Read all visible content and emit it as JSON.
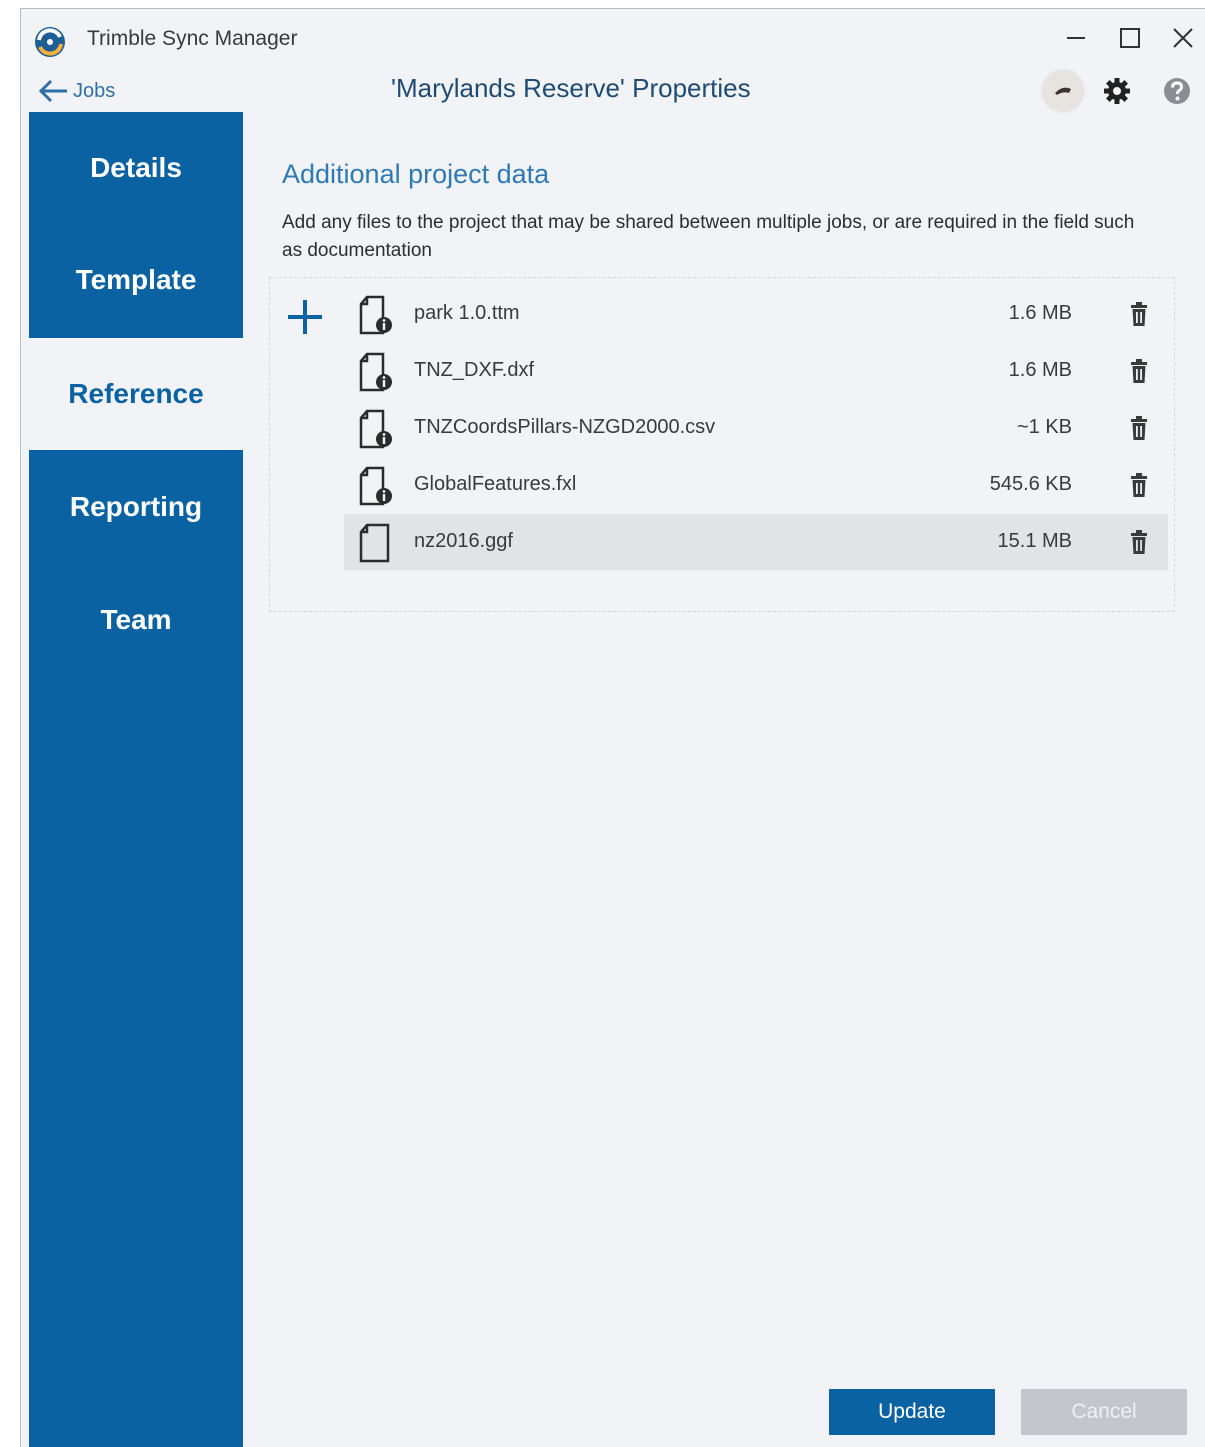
{
  "window": {
    "app_title": "Trimble Sync Manager",
    "controls": {
      "minimize": "minimize-icon",
      "maximize": "maximize-icon",
      "close": "close-icon"
    }
  },
  "header": {
    "back_label": "Jobs",
    "title": "'Marylands Reserve' Properties",
    "icons": [
      "avatar",
      "gear-icon",
      "help-icon"
    ]
  },
  "sidebar": {
    "items": [
      {
        "label": "Details",
        "active": false
      },
      {
        "label": "Template",
        "active": false
      },
      {
        "label": "Reference",
        "active": true
      },
      {
        "label": "Reporting",
        "active": false
      },
      {
        "label": "Team",
        "active": false
      }
    ]
  },
  "main": {
    "section_title": "Additional project data",
    "description": "Add any files to the project that may be shared between multiple jobs, or are required in the field such as documentation",
    "files": [
      {
        "name": "park 1.0.ttm",
        "size": "1.6 MB",
        "icon": "file-info-icon",
        "selected": false
      },
      {
        "name": "TNZ_DXF.dxf",
        "size": "1.6 MB",
        "icon": "file-info-icon",
        "selected": false
      },
      {
        "name": "TNZCoordsPillars-NZGD2000.csv",
        "size": "~1 KB",
        "icon": "file-info-icon",
        "selected": false
      },
      {
        "name": "GlobalFeatures.fxl",
        "size": "545.6 KB",
        "icon": "file-info-icon",
        "selected": false
      },
      {
        "name": "nz2016.ggf",
        "size": "15.1 MB",
        "icon": "file-icon",
        "selected": true
      }
    ]
  },
  "footer": {
    "update_label": "Update",
    "cancel_label": "Cancel"
  },
  "colors": {
    "accent": "#0a62a3",
    "background": "#f2f3f6",
    "selected_row": "#e1e3e7",
    "disabled_button": "#c3c6cc"
  }
}
